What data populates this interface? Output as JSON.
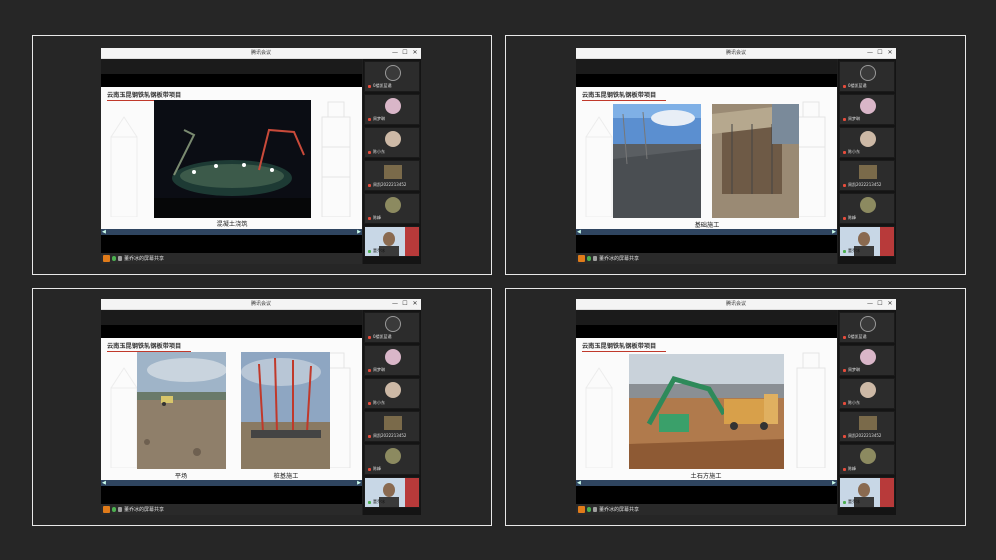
{
  "window": {
    "title": "腾讯会议",
    "min": "—",
    "max": "☐",
    "close": "✕"
  },
  "slide_heading": "云南玉昆钢铁轧钢板带项目",
  "share_status": "董乔冰的屏幕共享",
  "participants": [
    {
      "name": "0楼凯蓝谲",
      "avatar": "dark-photo-avatar",
      "color": "#3a3a3a"
    },
    {
      "name": "周梦琳",
      "avatar": "pink-photo-avatar",
      "color": "#d9b6c8"
    },
    {
      "name": "陈小东",
      "avatar": "portrait-photo-avatar",
      "color": "#cdb9a6"
    },
    {
      "name": "周凯2022213452",
      "avatar": "scene-photo-avatar",
      "color": "#7a6a4a"
    },
    {
      "name": "陈峰",
      "avatar": "olive-photo-avatar",
      "color": "#8c8a60"
    },
    {
      "name": "董乔冰",
      "avatar": "video-feed",
      "color": "#c8d7e6"
    }
  ],
  "panels": [
    {
      "captions": [
        "混凝土浇筑"
      ]
    },
    {
      "captions": [
        "基础施工"
      ]
    },
    {
      "captions": [
        "平场",
        "桩基施工"
      ]
    },
    {
      "captions": [
        "土石方施工"
      ]
    }
  ],
  "colors": {
    "accent_red": "#c0392b",
    "share_orange": "#e07b1a",
    "mic_green": "#4caf50"
  }
}
